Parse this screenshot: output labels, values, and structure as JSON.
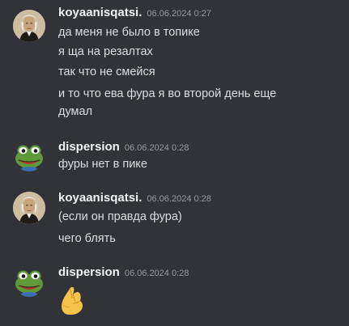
{
  "messages": [
    {
      "author": "koyaanisqatsi.",
      "timestamp": "06.06.2024 0:27",
      "avatar_icon": "portrait-avatar-icon",
      "lines": [
        "да меня не было в топике",
        "я ща на резалтах",
        "так что не смейся",
        "и то что ева фура я во второй день еще",
        "думал"
      ]
    },
    {
      "author": "dispersion",
      "timestamp": "06.06.2024 0:28",
      "avatar_icon": "frog-avatar-icon",
      "lines": [
        "фуры нет в пике"
      ]
    },
    {
      "author": "koyaanisqatsi.",
      "timestamp": "06.06.2024 0:28",
      "avatar_icon": "portrait-avatar-icon",
      "lines": [
        "(если он правда фура)",
        "чего блять"
      ]
    },
    {
      "author": "dispersion",
      "timestamp": "06.06.2024 0:28",
      "avatar_icon": "frog-avatar-icon",
      "lines": [],
      "emoji": "pinched-fingers-emoji-icon"
    }
  ],
  "colors": {
    "background": "#313338",
    "username": "#f2f3f5",
    "text": "#dbdee1",
    "timestamp": "#949ba4"
  }
}
